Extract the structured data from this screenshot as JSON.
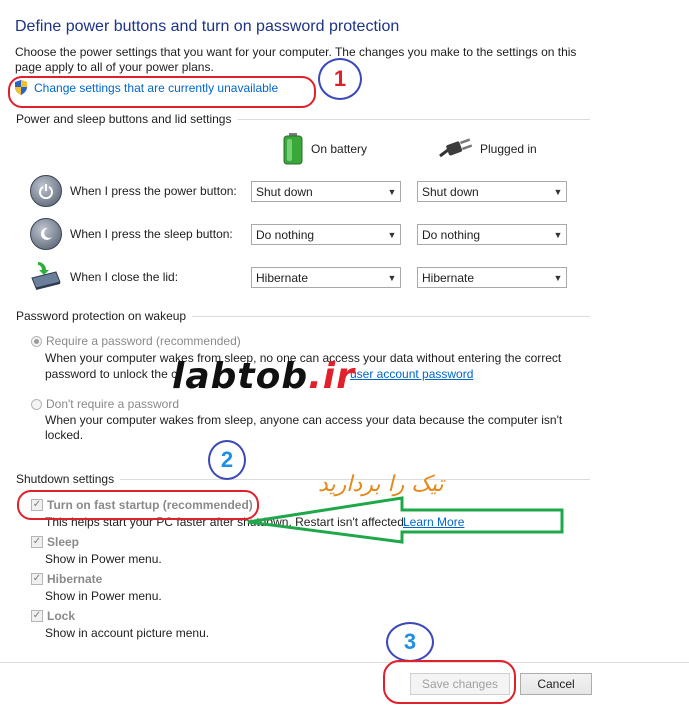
{
  "header": {
    "title": "Define power buttons and turn on password protection",
    "description": "Choose the power settings that you want for your computer. The changes you make to the settings on this page apply to all of your power plans.",
    "change_settings_link": "Change settings that are currently unavailable"
  },
  "power_section": {
    "title": "Power and sleep buttons and lid settings",
    "col_battery": "On battery",
    "col_plugged": "Plugged in",
    "rows": [
      {
        "label": "When I press the power button:",
        "battery": "Shut down",
        "plugged": "Shut down"
      },
      {
        "label": "When I press the sleep button:",
        "battery": "Do nothing",
        "plugged": "Do nothing"
      },
      {
        "label": "When I close the lid:",
        "battery": "Hibernate",
        "plugged": "Hibernate"
      }
    ]
  },
  "password_section": {
    "title": "Password protection on wakeup",
    "require_label": "Require a password (recommended)",
    "require_desc_1": "When your computer wakes from sleep, no one can access your data without entering the correct",
    "require_desc_2a": "password to unlock the c",
    "require_link": "user account password",
    "dont_label": "Don't require a password",
    "dont_desc": "When your computer wakes from sleep, anyone can access your data because the computer isn't locked."
  },
  "shutdown_section": {
    "title": "Shutdown settings",
    "items": [
      {
        "label": "Turn on fast startup (recommended)",
        "desc": "This helps start your PC faster after shutdown. Restart isn't affected.",
        "link": "Learn More"
      },
      {
        "label": "Sleep",
        "desc": "Show in Power menu."
      },
      {
        "label": "Hibernate",
        "desc": "Show in Power menu."
      },
      {
        "label": "Lock",
        "desc": "Show in account picture menu."
      }
    ]
  },
  "footer": {
    "save_label": "Save changes",
    "cancel_label": "Cancel"
  },
  "annotations": {
    "step_1": "1",
    "step_2": "2",
    "step_3": "3",
    "watermark_a": "labtob",
    "watermark_b": ".ir",
    "persian_note": "تیک را بردارید",
    "highlight_color": "#e0202a",
    "arrow_color": "#1fa84a"
  },
  "icons": {
    "shield": "uac-shield-icon",
    "battery": "battery-icon",
    "plug": "plug-icon",
    "power": "power-button-icon",
    "sleep": "sleep-button-icon",
    "lid": "laptop-lid-icon"
  }
}
